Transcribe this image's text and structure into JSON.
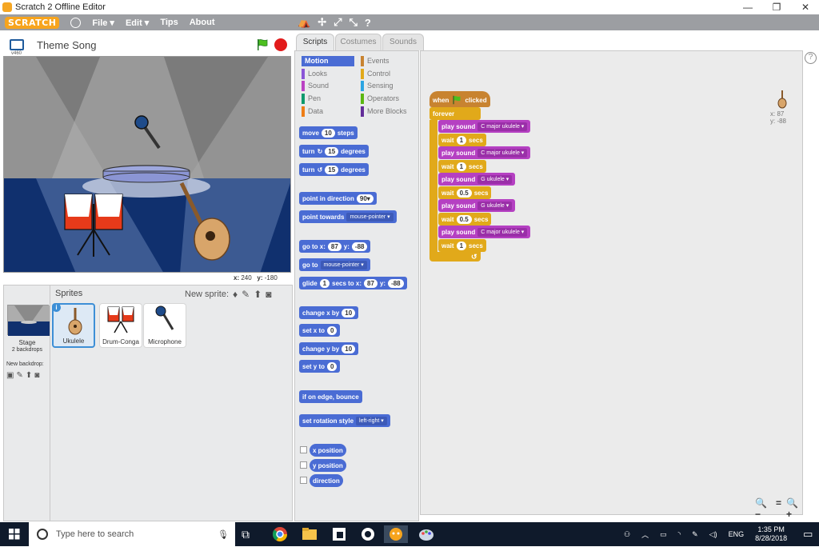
{
  "window": {
    "title": "Scratch 2 Offline Editor",
    "min": "—",
    "max": "❐",
    "close": "✕"
  },
  "menubar": {
    "logo": "SCRATCH",
    "file": "File ▾",
    "edit": "Edit ▾",
    "tips": "Tips",
    "about": "About"
  },
  "stage": {
    "version": "v460",
    "title": "Theme Song",
    "coords_x_label": "x:",
    "coords_x": "240",
    "coords_y_label": "y:",
    "coords_y": "-180"
  },
  "sprites": {
    "title": "Sprites",
    "new_sprite": "New sprite:",
    "stage_label": "Stage",
    "backdrops": "2 backdrops",
    "new_backdrop": "New backdrop:",
    "items": [
      {
        "name": "Ukulele"
      },
      {
        "name": "Drum-Conga"
      },
      {
        "name": "Microphone"
      }
    ]
  },
  "tabs": {
    "scripts": "Scripts",
    "costumes": "Costumes",
    "sounds": "Sounds"
  },
  "categories": {
    "motion": "Motion",
    "looks": "Looks",
    "sound": "Sound",
    "pen": "Pen",
    "data": "Data",
    "events": "Events",
    "control": "Control",
    "sensing": "Sensing",
    "operators": "Operators",
    "more": "More Blocks",
    "colors": {
      "motion": "#4a6cd4",
      "looks": "#8a55d7",
      "sound": "#bb42c3",
      "pen": "#0e9a6c",
      "data": "#ee7d16",
      "events": "#c88330",
      "control": "#e1a91a",
      "sensing": "#2ca5e2",
      "operators": "#5cb712",
      "more": "#632d99"
    }
  },
  "palette": {
    "move": "move",
    "move_val": "10",
    "steps": "steps",
    "turn": "turn",
    "turn_r_val": "15",
    "degrees": "degrees",
    "turn_l_val": "15",
    "point_dir": "point in direction",
    "dir_val": "90▾",
    "point_towards": "point towards",
    "mouse_pointer": "mouse-pointer ▾",
    "go_to_x": "go to x:",
    "gx": "87",
    "y_label": "y:",
    "gy": "-88",
    "go_to": "go to",
    "go_to_target": "mouse-pointer ▾",
    "glide": "glide",
    "glide_secs": "1",
    "secs_to_x": "secs to x:",
    "glx": "87",
    "gly": "-88",
    "change_x": "change x by",
    "cx_val": "10",
    "set_x": "set x to",
    "sx_val": "0",
    "change_y": "change y by",
    "cy_val": "10",
    "set_y": "set y to",
    "sy_val": "0",
    "bounce": "if on edge, bounce",
    "rot_style": "set rotation style",
    "rot_val": "left-right ▾",
    "x_position": "x position",
    "y_position": "y position",
    "direction": "direction"
  },
  "script": {
    "when": "when",
    "clicked": "clicked",
    "forever": "forever",
    "play_sound": "play sound",
    "wait": "wait",
    "secs": "secs",
    "steps": [
      {
        "kind": "sound",
        "value": "C major ukulele ▾"
      },
      {
        "kind": "wait",
        "value": "1"
      },
      {
        "kind": "sound",
        "value": "C major ukulele ▾"
      },
      {
        "kind": "wait",
        "value": "1"
      },
      {
        "kind": "sound",
        "value": "G ukulele ▾"
      },
      {
        "kind": "wait",
        "value": "0.5"
      },
      {
        "kind": "sound",
        "value": "G ukulele ▾"
      },
      {
        "kind": "wait",
        "value": "0.5"
      },
      {
        "kind": "sound",
        "value": "C major ukulele ▾"
      },
      {
        "kind": "wait",
        "value": "1"
      }
    ]
  },
  "sprite_info": {
    "x": "x: 87",
    "y": "y: -88"
  },
  "zoom": {
    "out": "🔍−",
    "reset": "=",
    "in": "🔍+"
  },
  "help": "?",
  "taskbar": {
    "search_placeholder": "Type here to search",
    "lang": "ENG",
    "time": "1:35 PM",
    "date": "8/28/2018"
  }
}
